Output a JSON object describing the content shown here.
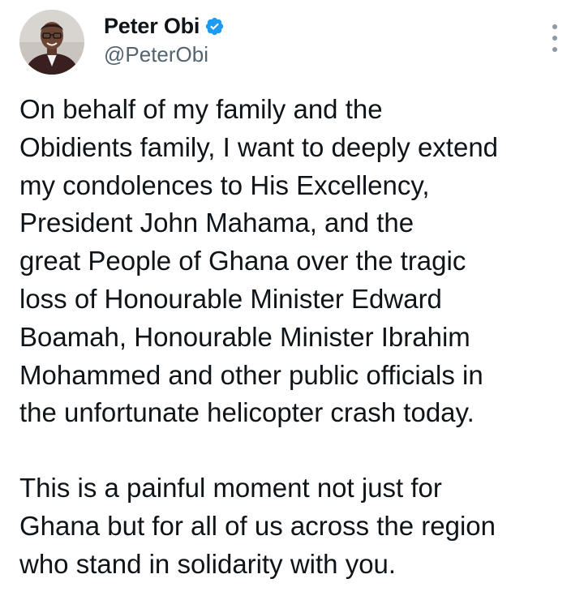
{
  "author": {
    "display_name": "Peter Obi",
    "handle": "@PeterObi",
    "verified": true,
    "verified_color": "#1d9bf0"
  },
  "menu": {
    "icon": "more-vertical-icon"
  },
  "tweet": {
    "paragraphs": [
      "On behalf of my family and the\nObidients family, I want to deeply extend\nmy condolences to His Excellency,\nPresident John Mahama, and the\ngreat People of Ghana over the tragic\nloss of Honourable Minister Edward\nBoamah, Honourable Minister Ibrahim\nMohammed and other public officials in\nthe unfortunate helicopter crash today.",
      "This is a painful moment not just for\nGhana but for all of us across the region\nwho stand in solidarity with you."
    ]
  }
}
